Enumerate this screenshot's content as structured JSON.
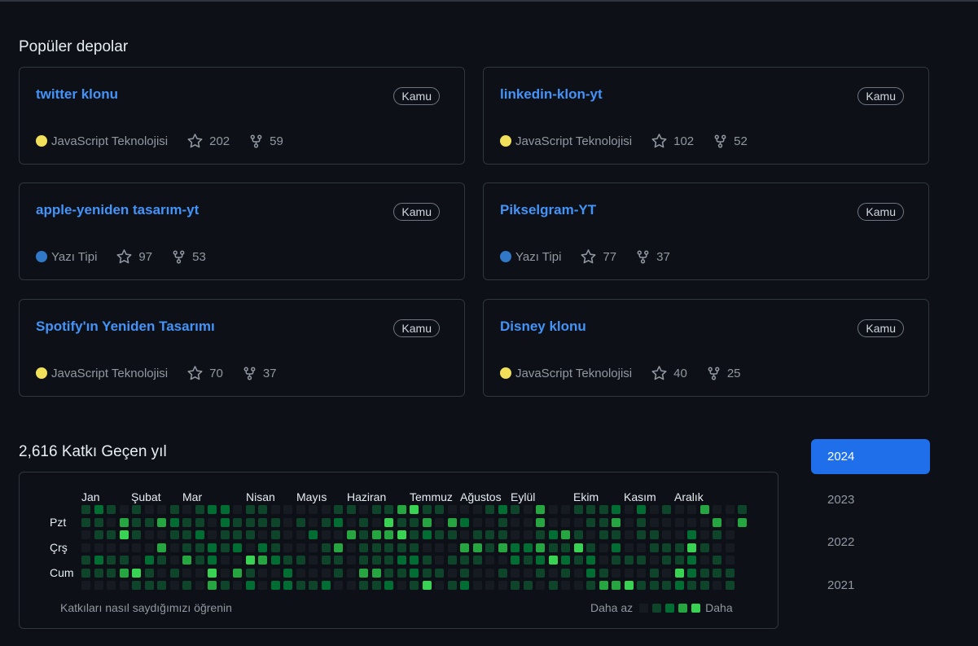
{
  "popular": {
    "title": "Popüler depolar",
    "repos": [
      {
        "name": "twitter klonu",
        "visibility": "Kamu",
        "language": "JavaScript Teknolojisi",
        "lang_color": "#f1e05a",
        "stars": "202",
        "forks": "59"
      },
      {
        "name": "linkedin-klon-yt",
        "visibility": "Kamu",
        "language": "JavaScript Teknolojisi",
        "lang_color": "#f1e05a",
        "stars": "102",
        "forks": "52"
      },
      {
        "name": "apple-yeniden tasarım-yt",
        "visibility": "Kamu",
        "language": "Yazı Tipi",
        "lang_color": "#3178c6",
        "stars": "97",
        "forks": "53"
      },
      {
        "name": "Pikselgram-YT",
        "visibility": "Kamu",
        "language": "Yazı Tipi",
        "lang_color": "#3178c6",
        "stars": "77",
        "forks": "37"
      },
      {
        "name": "Spotify'ın Yeniden Tasarımı",
        "visibility": "Kamu",
        "language": "JavaScript Teknolojisi",
        "lang_color": "#f1e05a",
        "stars": "70",
        "forks": "37"
      },
      {
        "name": "Disney klonu",
        "visibility": "Kamu",
        "language": "JavaScript Teknolojisi",
        "lang_color": "#f1e05a",
        "stars": "40",
        "forks": "25"
      }
    ]
  },
  "contributions": {
    "title": "2,616 Katkı Geçen yıl",
    "months": [
      "Jan",
      "Şubat",
      "Mar",
      "Nisan",
      "Mayıs",
      "Haziran",
      "Temmuz",
      "Ağustos",
      "Eylül",
      "Ekim",
      "Kasım",
      "Aralık"
    ],
    "days": [
      "Pzt",
      "Çrş",
      "Cum"
    ],
    "learn_link": "Katkıları nasıl saydığımızı öğrenin",
    "legend_less": "Daha az",
    "legend_more": "Daha",
    "level_colors": [
      "#161b22",
      "#0e4429",
      "#006d32",
      "#26a641",
      "#39d353"
    ]
  },
  "years": {
    "items": [
      "2024",
      "2023",
      "2022",
      "2021"
    ],
    "active": "2024"
  }
}
